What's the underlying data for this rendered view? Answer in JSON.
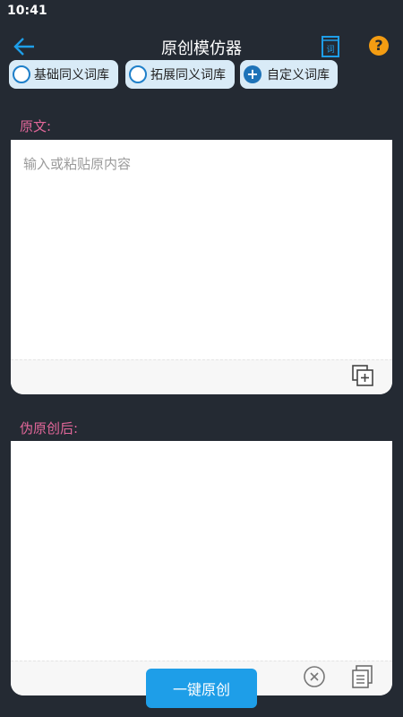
{
  "status_bar": {
    "time": "10:41"
  },
  "app_bar": {
    "title": "原创模仿器",
    "help_glyph": "?"
  },
  "chips": [
    {
      "label": "基础同义词库",
      "icon": "radio-unchecked-icon"
    },
    {
      "label": "拓展同义词库",
      "icon": "radio-unchecked-icon"
    },
    {
      "label": "自定义词库",
      "icon": "plus-circle-icon"
    }
  ],
  "source": {
    "label": "原文:",
    "placeholder": "输入或粘贴原内容"
  },
  "result": {
    "label": "伪原创后:"
  },
  "actions": {
    "convert_label": "一键原创"
  },
  "colors": {
    "background": "#242a33",
    "accent": "#1e9ee8",
    "label": "#e2679a",
    "help": "#f39c12"
  }
}
